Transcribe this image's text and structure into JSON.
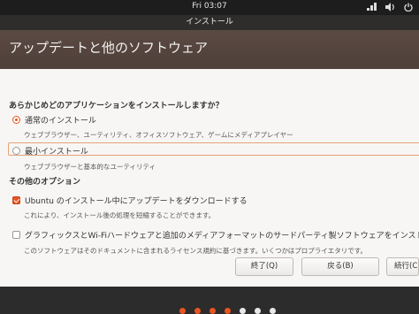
{
  "topbar": {
    "clock": "Fri 03:07",
    "icons": [
      "network-icon",
      "volume-icon",
      "power-icon"
    ]
  },
  "window": {
    "title": "インストール",
    "header": "アップデートと他のソフトウェア"
  },
  "install_type": {
    "question": "あらかじめどのアプリケーションをインストールしますか？",
    "normal_label": "通常のインストール",
    "normal_desc": "ウェブブラウザー、ユーティリティ、オフィスソフトウェア、ゲームにメディアプレイヤー",
    "normal_selected": true,
    "minimal_label": "最小インストール",
    "minimal_desc": "ウェブブラウザーと基本的なユーティリティ",
    "minimal_selected": false
  },
  "other_options": {
    "section": "その他のオプション",
    "updates_label": "Ubuntu のインストール中にアップデートをダウンロードする",
    "updates_desc": "これにより、インストール後の処理を短縮することができます。",
    "updates_checked": true,
    "thirdparty_label": "グラフィックスとWi-Fiハードウェアと追加のメディアフォーマットのサードパーティ製ソフトウェアをインストールする",
    "thirdparty_desc": "このソフトウェアはそのドキュメントに含まれるライセンス規約に基づきます。いくつかはプロプライエタリです。",
    "thirdparty_checked": false
  },
  "buttons": {
    "quit": "終了(Q)",
    "back": "戻る(B)",
    "continue": "続行(C)"
  },
  "progress": {
    "total_steps": 7,
    "completed_steps": 4,
    "colors": {
      "done": "#e95420",
      "todo": "#e8e8e8",
      "accent": "#e95420"
    }
  }
}
